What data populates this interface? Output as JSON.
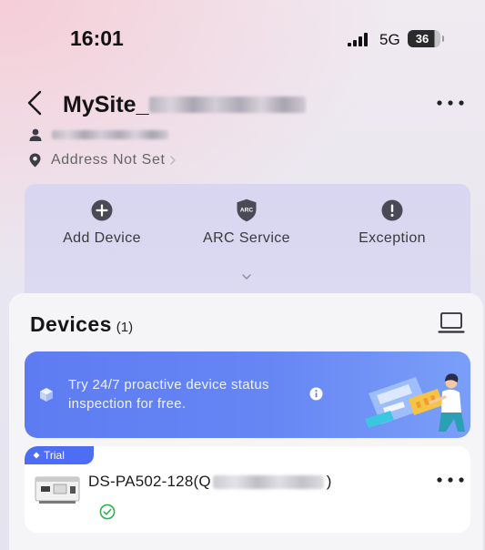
{
  "status_bar": {
    "time": "16:01",
    "network": "5G",
    "battery": "36",
    "signal_icon": "signal-bars-icon"
  },
  "header": {
    "site_name": "MySite_",
    "back_icon": "chevron-left-icon",
    "more_icon": "more-horizontal-icon"
  },
  "site_info": {
    "user_icon": "user-icon",
    "address_icon": "location-pin-icon",
    "address": "Address Not Set",
    "address_chevron_icon": "chevron-right-icon"
  },
  "quick_actions": [
    {
      "label": "Add Device",
      "icon": "plus-circle-icon"
    },
    {
      "label": "ARC Service",
      "icon": "arc-shield-icon",
      "icon_text": "ARC"
    },
    {
      "label": "Exception",
      "icon": "exclamation-circle-icon"
    }
  ],
  "expand_icon": "chevron-down-icon",
  "devices": {
    "title": "Devices",
    "count": "(1)",
    "view_icon": "monitor-icon"
  },
  "banner": {
    "lines": [
      "Try 24/7 proactive device status",
      "inspection for free."
    ],
    "leading_icon": "cube-icon",
    "info_icon": "info-icon"
  },
  "device_card": {
    "badge": "Trial",
    "name_prefix": "DS-PA502-128(Q",
    "name_suffix": ")",
    "status_icon": "check-circle-icon",
    "more_icon": "more-horizontal-icon"
  },
  "colors": {
    "accent": "#4d6ef4",
    "banner": "#5d7cf2",
    "status_ok": "#2fb350",
    "quick_panel": "#dcdbf2",
    "icon_dark": "#4a4a56"
  }
}
